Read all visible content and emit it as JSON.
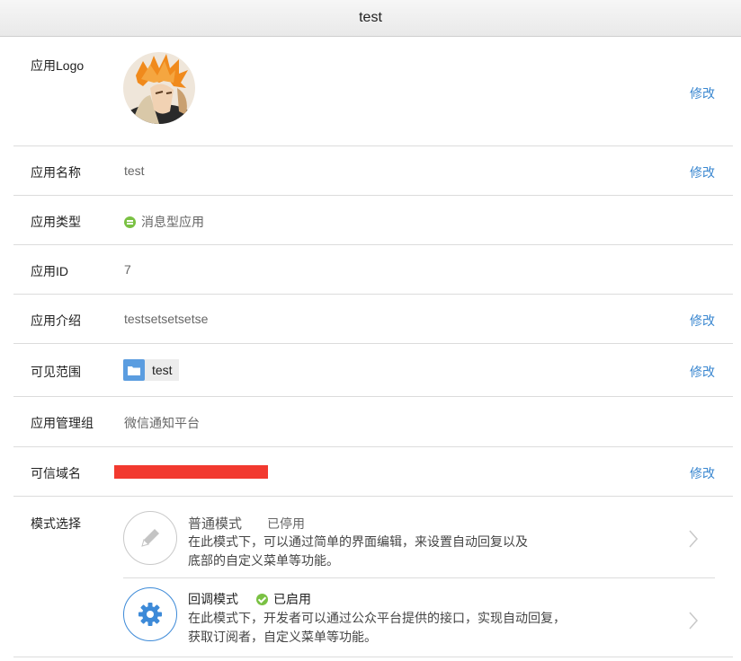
{
  "window": {
    "title": "test"
  },
  "colors": {
    "link": "#3a87d0",
    "status_green": "#7ac143",
    "folder_blue": "#5b9de0",
    "redaction": "#f2392f"
  },
  "rows": {
    "logo": {
      "label": "应用Logo",
      "edit": "修改"
    },
    "name": {
      "label": "应用名称",
      "value": "test",
      "edit": "修改"
    },
    "type": {
      "label": "应用类型",
      "value": "消息型应用",
      "icon": "message-type-icon"
    },
    "id": {
      "label": "应用ID",
      "value": "7"
    },
    "intro": {
      "label": "应用介绍",
      "value": "testsetsetsetse",
      "edit": "修改"
    },
    "scope": {
      "label": "可见范围",
      "value": "test",
      "icon": "folder-icon",
      "edit": "修改"
    },
    "admin_group": {
      "label": "应用管理组",
      "value": "微信通知平台"
    },
    "domain": {
      "label": "可信域名",
      "edit": "修改"
    },
    "mode": {
      "label": "模式选择",
      "items": [
        {
          "title": "普通模式",
          "status": "已停用",
          "icon": "pencil-icon",
          "desc_line1": "在此模式下，可以通过简单的界面编辑，来设置自动回复以及",
          "desc_line2": "底部的自定义菜单等功能。"
        },
        {
          "title": "回调模式",
          "status": "已启用",
          "icon": "gear-icon",
          "desc_line1": "在此模式下，开发者可以通过公众平台提供的接口，实现自动回复，",
          "desc_line2": "获取订阅者，自定义菜单等功能。"
        }
      ]
    }
  }
}
